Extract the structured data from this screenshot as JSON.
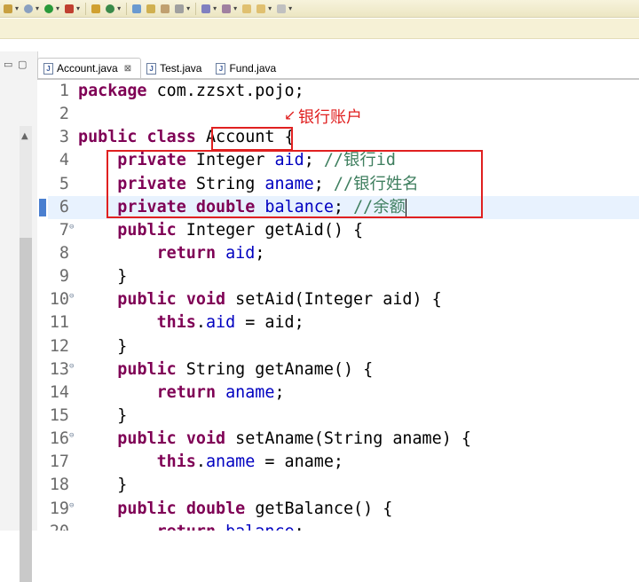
{
  "editor": {
    "tabs": [
      {
        "label": "Account.java",
        "active": true,
        "closable": true
      },
      {
        "label": "Test.java",
        "active": false
      },
      {
        "label": "Fund.java",
        "active": false
      }
    ],
    "lines": [
      {
        "n": "1",
        "fold": "",
        "tokens": [
          [
            "kw",
            "package"
          ],
          [
            "txt",
            " com.zzsxt.pojo;"
          ]
        ]
      },
      {
        "n": "2",
        "fold": "",
        "tokens": []
      },
      {
        "n": "3",
        "fold": "",
        "tokens": [
          [
            "kw",
            "public"
          ],
          [
            "txt",
            " "
          ],
          [
            "kw",
            "class"
          ],
          [
            "txt",
            " Account {"
          ]
        ]
      },
      {
        "n": "4",
        "fold": "",
        "tokens": [
          [
            "txt",
            "    "
          ],
          [
            "kw",
            "private"
          ],
          [
            "txt",
            " Integer "
          ],
          [
            "field",
            "aid"
          ],
          [
            "txt",
            "; "
          ],
          [
            "cm",
            "//银行id"
          ]
        ]
      },
      {
        "n": "5",
        "fold": "",
        "tokens": [
          [
            "txt",
            "    "
          ],
          [
            "kw",
            "private"
          ],
          [
            "txt",
            " String "
          ],
          [
            "field",
            "aname"
          ],
          [
            "txt",
            "; "
          ],
          [
            "cm",
            "//银行姓名"
          ]
        ]
      },
      {
        "n": "6",
        "fold": "",
        "current": true,
        "tokens": [
          [
            "txt",
            "    "
          ],
          [
            "kw",
            "private"
          ],
          [
            "txt",
            " "
          ],
          [
            "kw",
            "double"
          ],
          [
            "txt",
            " "
          ],
          [
            "field",
            "balance"
          ],
          [
            "txt",
            "; "
          ],
          [
            "cm",
            "//余额"
          ]
        ]
      },
      {
        "n": "7",
        "fold": "⊖",
        "tokens": [
          [
            "txt",
            "    "
          ],
          [
            "kw",
            "public"
          ],
          [
            "txt",
            " Integer getAid() {"
          ]
        ]
      },
      {
        "n": "8",
        "fold": "",
        "tokens": [
          [
            "txt",
            "        "
          ],
          [
            "kw",
            "return"
          ],
          [
            "txt",
            " "
          ],
          [
            "field",
            "aid"
          ],
          [
            "txt",
            ";"
          ]
        ]
      },
      {
        "n": "9",
        "fold": "",
        "tokens": [
          [
            "txt",
            "    }"
          ]
        ]
      },
      {
        "n": "10",
        "fold": "⊖",
        "tokens": [
          [
            "txt",
            "    "
          ],
          [
            "kw",
            "public"
          ],
          [
            "txt",
            " "
          ],
          [
            "kw",
            "void"
          ],
          [
            "txt",
            " setAid(Integer aid) {"
          ]
        ]
      },
      {
        "n": "11",
        "fold": "",
        "tokens": [
          [
            "txt",
            "        "
          ],
          [
            "kw",
            "this"
          ],
          [
            "txt",
            "."
          ],
          [
            "field",
            "aid"
          ],
          [
            "txt",
            " = aid;"
          ]
        ]
      },
      {
        "n": "12",
        "fold": "",
        "tokens": [
          [
            "txt",
            "    }"
          ]
        ]
      },
      {
        "n": "13",
        "fold": "⊖",
        "tokens": [
          [
            "txt",
            "    "
          ],
          [
            "kw",
            "public"
          ],
          [
            "txt",
            " String getAname() {"
          ]
        ]
      },
      {
        "n": "14",
        "fold": "",
        "tokens": [
          [
            "txt",
            "        "
          ],
          [
            "kw",
            "return"
          ],
          [
            "txt",
            " "
          ],
          [
            "field",
            "aname"
          ],
          [
            "txt",
            ";"
          ]
        ]
      },
      {
        "n": "15",
        "fold": "",
        "tokens": [
          [
            "txt",
            "    }"
          ]
        ]
      },
      {
        "n": "16",
        "fold": "⊖",
        "tokens": [
          [
            "txt",
            "    "
          ],
          [
            "kw",
            "public"
          ],
          [
            "txt",
            " "
          ],
          [
            "kw",
            "void"
          ],
          [
            "txt",
            " setAname(String aname) {"
          ]
        ]
      },
      {
        "n": "17",
        "fold": "",
        "tokens": [
          [
            "txt",
            "        "
          ],
          [
            "kw",
            "this"
          ],
          [
            "txt",
            "."
          ],
          [
            "field",
            "aname"
          ],
          [
            "txt",
            " = aname;"
          ]
        ]
      },
      {
        "n": "18",
        "fold": "",
        "tokens": [
          [
            "txt",
            "    }"
          ]
        ]
      },
      {
        "n": "19",
        "fold": "⊖",
        "tokens": [
          [
            "txt",
            "    "
          ],
          [
            "kw",
            "public"
          ],
          [
            "txt",
            " "
          ],
          [
            "kw",
            "double"
          ],
          [
            "txt",
            " getBalance() {"
          ]
        ]
      },
      {
        "n": "20",
        "fold": "",
        "tokens": [
          [
            "txt",
            "        "
          ],
          [
            "kw",
            "return"
          ],
          [
            "txt",
            " "
          ],
          [
            "field",
            "balance"
          ],
          [
            "txt",
            ";"
          ]
        ]
      }
    ]
  },
  "annotation": {
    "label": "银行账户",
    "color": "#e02020"
  },
  "colors": {
    "keyword": "#7f0055",
    "field": "#0000c0",
    "comment": "#3f7f5f",
    "current_line": "#e8f2fe"
  },
  "icons": {
    "toolbar": [
      "gear-icon",
      "run-icon",
      "debug-icon",
      "new-icon",
      "refresh-icon",
      "folder-icon",
      "pin-icon",
      "nav-back-icon",
      "nav-forward-icon"
    ],
    "tab": "java-file-icon",
    "tab_close": "close-icon"
  }
}
